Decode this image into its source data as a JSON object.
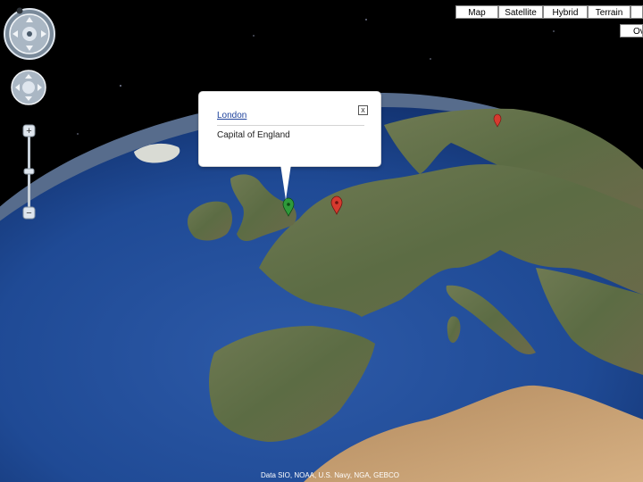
{
  "map_type_buttons": [
    {
      "label": "Map"
    },
    {
      "label": "Satellite"
    },
    {
      "label": "Hybrid"
    },
    {
      "label": "Terrain"
    }
  ],
  "overview_label": "Ove",
  "info_window": {
    "title": "London",
    "description": "Capital of England",
    "close_glyph": "x"
  },
  "attribution": "Data SIO, NOAA, U.S. Navy, NGA, GEBCO",
  "icons": {
    "selected_marker": "green-pin-icon",
    "other_markers": "red-pin-icon",
    "zoom_in": "plus-icon",
    "zoom_out": "minus-icon"
  },
  "colors": {
    "selected_marker": "#2e9a3a",
    "marker": "#d63a2f",
    "link": "#1a3f9a"
  }
}
